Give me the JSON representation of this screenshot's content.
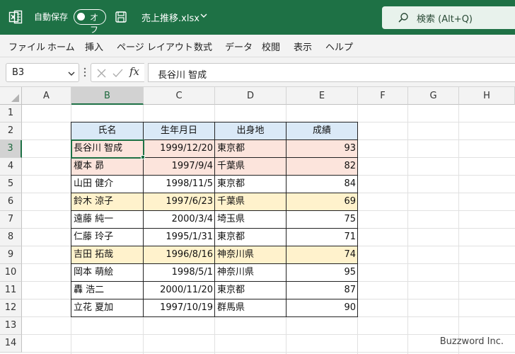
{
  "titlebar": {
    "autosave_label": "自動保存",
    "autosave_state": "オフ",
    "filename": "売上推移.xlsx",
    "search_placeholder": "検索 (Alt+Q)",
    "bg_color": "#1e7145",
    "icons": [
      "excel-icon",
      "save-icon",
      "chevron-down-icon",
      "search-icon"
    ]
  },
  "menu": [
    "ファイル",
    "ホーム",
    "挿入",
    "ページ レイアウト",
    "数式",
    "データ",
    "校閲",
    "表示",
    "ヘルプ"
  ],
  "formula_bar": {
    "name_box": "B3",
    "fx_label": "fx",
    "content": "長谷川 智成"
  },
  "grid": {
    "columns": [
      "A",
      "B",
      "C",
      "D",
      "E",
      "F",
      "G",
      "H"
    ],
    "rows": [
      "1",
      "2",
      "3",
      "4",
      "5",
      "6",
      "7",
      "8",
      "9",
      "10",
      "11",
      "12",
      "13",
      "14"
    ],
    "selected_column": "B",
    "selected_row": "3",
    "active_cell": "B3"
  },
  "table": {
    "headers": [
      "氏名",
      "生年月日",
      "出身地",
      "成績"
    ],
    "header_fill": "#dae9f7",
    "highlight_colors": {
      "red": "#fce4dc",
      "yellow": "#fff2cc"
    },
    "rows": [
      {
        "name": "長谷川 智成",
        "birth": "1999/12/20",
        "origin": "東京都",
        "score": "93",
        "highlight": "red"
      },
      {
        "name": "榎本 昴",
        "birth": "1997/9/4",
        "origin": "千葉県",
        "score": "82",
        "highlight": "red"
      },
      {
        "name": "山田 健介",
        "birth": "1998/11/5",
        "origin": "東京都",
        "score": "84",
        "highlight": ""
      },
      {
        "name": "鈴木 涼子",
        "birth": "1997/6/23",
        "origin": "千葉県",
        "score": "69",
        "highlight": "yellow"
      },
      {
        "name": "遠藤 純一",
        "birth": "2000/3/4",
        "origin": "埼玉県",
        "score": "75",
        "highlight": ""
      },
      {
        "name": "仁藤 玲子",
        "birth": "1995/1/31",
        "origin": "東京都",
        "score": "71",
        "highlight": ""
      },
      {
        "name": "吉田 拓哉",
        "birth": "1996/8/16",
        "origin": "神奈川県",
        "score": "74",
        "highlight": "yellow"
      },
      {
        "name": "岡本 萌絵",
        "birth": "1998/5/1",
        "origin": "神奈川県",
        "score": "95",
        "highlight": ""
      },
      {
        "name": "轟 浩二",
        "birth": "2000/11/20",
        "origin": "東京都",
        "score": "87",
        "highlight": ""
      },
      {
        "name": "立花 夏加",
        "birth": "1997/10/19",
        "origin": "群馬県",
        "score": "90",
        "highlight": ""
      }
    ]
  },
  "watermark": "Buzzword Inc."
}
